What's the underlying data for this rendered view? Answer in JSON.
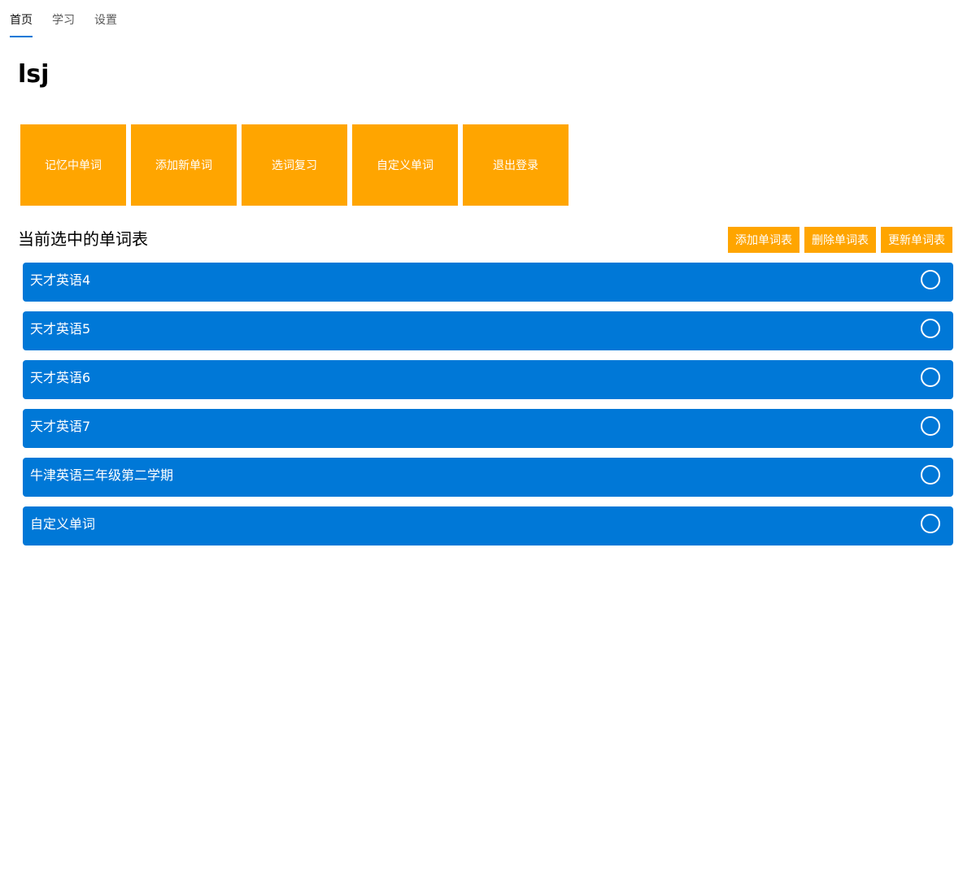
{
  "colors": {
    "accent": "#0078d7",
    "tile": "#ffa500",
    "list_item": "#0078d7"
  },
  "nav": {
    "tabs": [
      {
        "label": "首页",
        "active": true
      },
      {
        "label": "学习",
        "active": false
      },
      {
        "label": "设置",
        "active": false
      }
    ]
  },
  "user": {
    "name": "lsj"
  },
  "tiles": [
    {
      "label": "记忆中单词"
    },
    {
      "label": "添加新单词"
    },
    {
      "label": "选词复习"
    },
    {
      "label": "自定义单词"
    },
    {
      "label": "退出登录"
    }
  ],
  "wordlists": {
    "title": "当前选中的单词表",
    "actions": {
      "add_label": "添加单词表",
      "delete_label": "删除单词表",
      "update_label": "更新单词表"
    },
    "items": [
      {
        "label": "天才英语4",
        "selected": false
      },
      {
        "label": "天才英语5",
        "selected": false
      },
      {
        "label": "天才英语6",
        "selected": false
      },
      {
        "label": "天才英语7",
        "selected": false
      },
      {
        "label": "牛津英语三年级第二学期",
        "selected": false
      },
      {
        "label": "自定义单词",
        "selected": false
      }
    ]
  }
}
